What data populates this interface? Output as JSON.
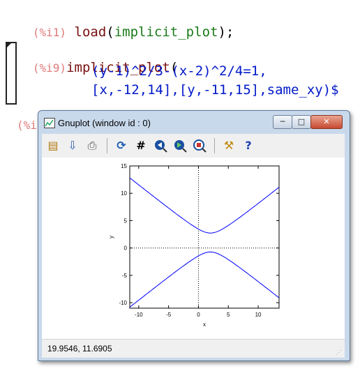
{
  "session": {
    "line1": {
      "prompt": "(%i1)",
      "func": "load",
      "open": "(",
      "arg": "implicit_plot",
      "close": ");"
    },
    "line9": {
      "prompt": "(%i9)",
      "func": "implicit_plot",
      "open": "("
    },
    "line9b": {
      "text": "(y-1)^2/3-(x-2)^2/4=1,"
    },
    "line9c": {
      "text": "[x,-12,14],[y,-11,15],same_xy)$"
    },
    "out_prompt_partial": "(%i"
  },
  "window": {
    "title": "Gnuplot (window id : 0)",
    "buttons": {
      "minimize": "─",
      "maximize": "□",
      "close": "✕"
    },
    "toolbar": [
      {
        "name": "clipboard-icon",
        "glyph": "📋"
      },
      {
        "name": "export-icon",
        "glyph": "💾"
      },
      {
        "name": "print-icon",
        "glyph": "🖶"
      },
      {
        "name": "replot-icon",
        "glyph": "⟳"
      },
      {
        "name": "grid-icon",
        "glyph": "#"
      },
      {
        "name": "zoom-prev-icon",
        "glyph": "◀"
      },
      {
        "name": "zoom-next-icon",
        "glyph": "▶"
      },
      {
        "name": "autoscale-icon",
        "glyph": "⊡"
      },
      {
        "name": "options-icon",
        "glyph": "🔧"
      },
      {
        "name": "help-icon",
        "glyph": "?"
      }
    ],
    "status": "19.9546,  11.6905"
  },
  "chart_data": {
    "type": "line",
    "title": "",
    "xlabel": "x",
    "ylabel": "y",
    "xlim": [
      -11.5,
      13.5
    ],
    "ylim": [
      -11,
      15
    ],
    "xticks": [
      "-10",
      "-5",
      "0",
      "5",
      "10"
    ],
    "yticks": [
      "15",
      "10",
      "5",
      "0",
      "-5",
      "-10"
    ],
    "grid": false,
    "axes_through_origin": true,
    "series": [
      {
        "color": "#0000ff",
        "equation": "(y-1)^2/3-(x-2)^2/4=1",
        "branch": "upper"
      },
      {
        "color": "#0000ff",
        "equation": "(y-1)^2/3-(x-2)^2/4=1",
        "branch": "lower"
      }
    ]
  }
}
